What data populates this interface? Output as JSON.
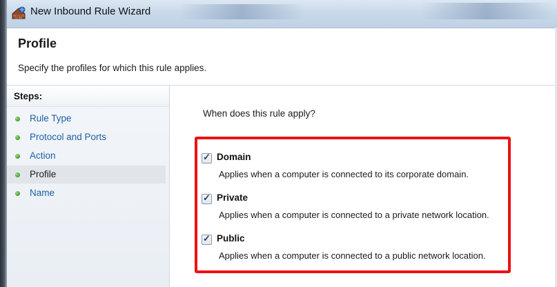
{
  "window": {
    "title": "New Inbound Rule Wizard",
    "icon": "firewall-icon"
  },
  "header": {
    "title": "Profile",
    "description": "Specify the profiles for which this rule applies."
  },
  "steps": {
    "heading": "Steps:",
    "items": [
      {
        "label": "Rule Type",
        "active": false
      },
      {
        "label": "Protocol and Ports",
        "active": false
      },
      {
        "label": "Action",
        "active": false
      },
      {
        "label": "Profile",
        "active": true
      },
      {
        "label": "Name",
        "active": false
      }
    ]
  },
  "content": {
    "question": "When does this rule apply?",
    "profiles": [
      {
        "name": "Domain",
        "checked": true,
        "description": "Applies when a computer is connected to its corporate domain."
      },
      {
        "name": "Private",
        "checked": true,
        "description": "Applies when a computer is connected to a private network location."
      },
      {
        "name": "Public",
        "checked": true,
        "description": "Applies when a computer is connected to a public network location."
      }
    ]
  },
  "colors": {
    "highlight": "#ee1111",
    "link": "#1f5fa5",
    "bullet": "#3f9a2c"
  }
}
